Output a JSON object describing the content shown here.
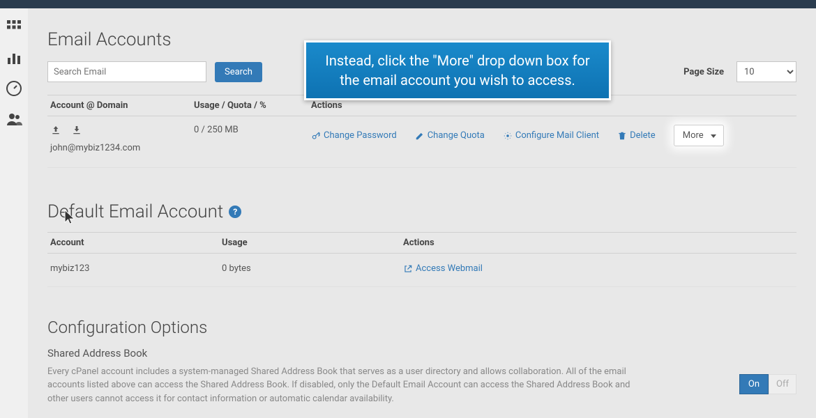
{
  "page": {
    "title": "Email Accounts",
    "search_placeholder": "Search Email",
    "search_button": "Search",
    "pagesize_label": "Page Size",
    "pagesize_value": "10"
  },
  "table": {
    "headers": {
      "account": "Account @ Domain",
      "usage": "Usage / Quota / %",
      "actions": "Actions"
    },
    "row": {
      "email": "john@mybiz1234.com",
      "usage": "0 / 250 MB",
      "change_password": "Change Password",
      "change_quota": "Change Quota",
      "configure": "Configure Mail Client",
      "delete": "Delete",
      "more": "More"
    }
  },
  "default_section": {
    "title": "Default Email Account",
    "headers": {
      "account": "Account",
      "usage": "Usage",
      "actions": "Actions"
    },
    "row": {
      "account": "mybiz123",
      "usage": "0 bytes",
      "access": "Access Webmail"
    }
  },
  "config": {
    "title": "Configuration Options",
    "subtitle": "Shared Address Book",
    "description": "Every cPanel account includes a system-managed Shared Address Book that serves as a user directory and allows collaboration. All of the email accounts listed above can access the Shared Address Book. If disabled, only the Default Email Account can access the Shared Address Book and other users cannot access it for contact information or automatic calendar availability.",
    "on": "On",
    "off": "Off"
  },
  "instruction": "Instead, click the \"More\" drop down box for the email account you wish to access."
}
